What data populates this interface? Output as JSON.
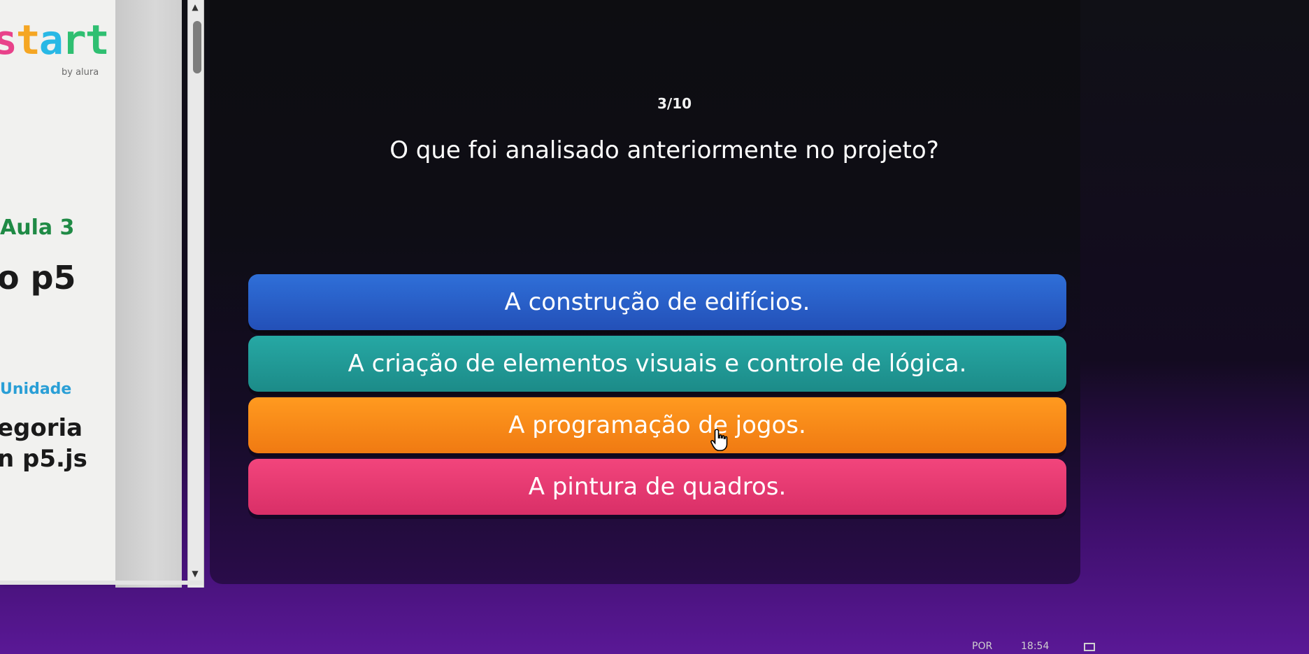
{
  "sidebar": {
    "logo": {
      "letters": [
        "s",
        "t",
        "a",
        "r",
        "t"
      ],
      "by_text": "by alura",
      "colors": [
        "#e8428a",
        "#f5a623",
        "#29b8e5",
        "#2fbf71",
        "#2fbf71"
      ]
    },
    "aula_label": "Aula 3",
    "course_title": "o p5",
    "unidade_label": "Unidade",
    "categoria_label": "egoria",
    "categoria_value": "n p5.js"
  },
  "quiz": {
    "progress": "3/10",
    "question": "O que foi analisado anteriormente no projeto?",
    "answers": [
      {
        "label": "A construção de edifícios.",
        "color": "#2f6fd8"
      },
      {
        "label": "A criação de elementos visuais e controle de lógica.",
        "color": "#26a8a4"
      },
      {
        "label": "A programação de jogos.",
        "color": "#ff9a1f"
      },
      {
        "label": "A pintura de quadros.",
        "color": "#f2457c"
      }
    ]
  },
  "taskbar": {
    "lang": "POR",
    "time": "18:54"
  },
  "colors": {
    "background_top": "#0d0d11",
    "background_bottom": "#5a1896"
  }
}
